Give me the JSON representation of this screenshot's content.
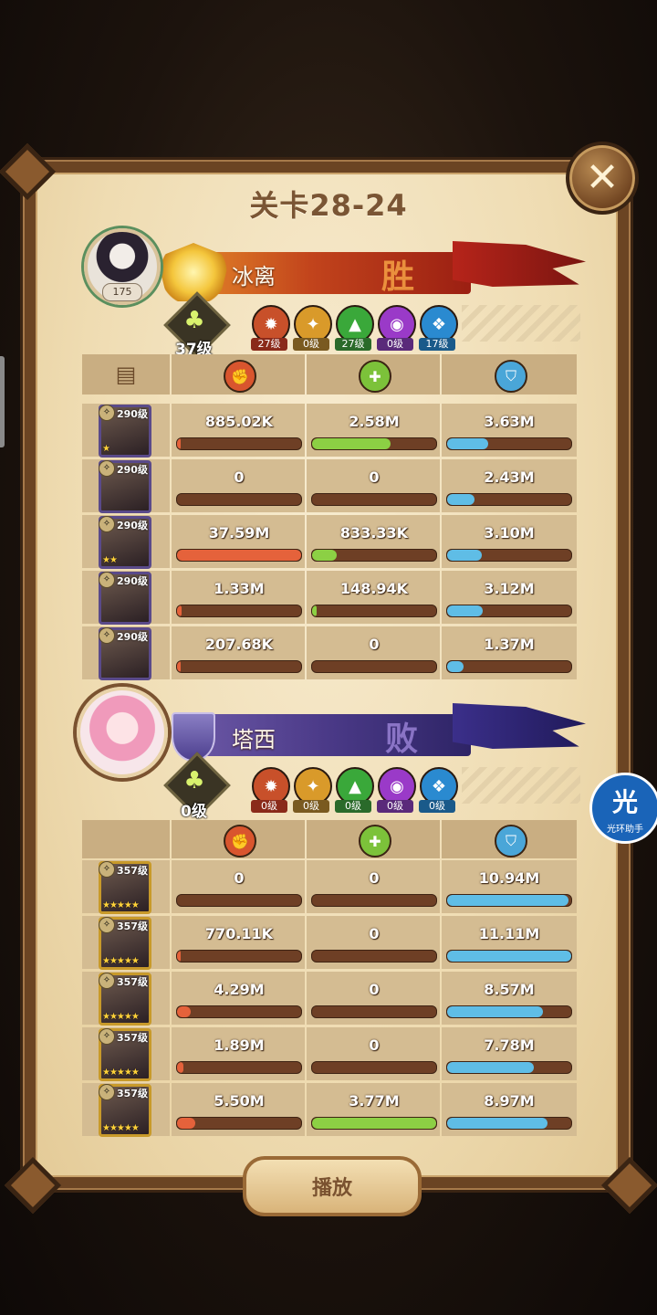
{
  "title": "关卡28-24",
  "close_glyph": "✕",
  "play_label": "播放",
  "floating_widget": {
    "main": "光",
    "sub": "光环助手"
  },
  "icons": {
    "damage": "fist-icon",
    "heal": "heal-icon",
    "defense": "shield-icon",
    "tree": "tree-icon",
    "book": "book-icon"
  },
  "colors": {
    "damage_bar": "#e5623b",
    "heal_bar": "#8cd044",
    "defense_bar": "#5fbde6",
    "win_banner": "#c2441c",
    "lose_banner": "#4b3a88"
  },
  "team_win": {
    "name": "冰离",
    "result": "胜",
    "player_level": "175",
    "tree_level": "37级",
    "factions": [
      {
        "name": "lightbearer",
        "level": "27级"
      },
      {
        "name": "mauler",
        "level": "0级"
      },
      {
        "name": "wilder",
        "level": "27级"
      },
      {
        "name": "graveborn",
        "level": "0级"
      },
      {
        "name": "celestial",
        "level": "17级"
      }
    ],
    "heroes": [
      {
        "level": "290级",
        "stars": "★",
        "damage": "885.02K",
        "damage_pct": 0.02,
        "heal": "2.58M",
        "heal_pct": 0.63,
        "defense": "3.63M",
        "defense_pct": 0.33
      },
      {
        "level": "290级",
        "stars": "",
        "damage": "0",
        "damage_pct": 0,
        "heal": "0",
        "heal_pct": 0,
        "defense": "2.43M",
        "defense_pct": 0.22
      },
      {
        "level": "290级",
        "stars": "★★",
        "damage": "37.59M",
        "damage_pct": 1.0,
        "heal": "833.33K",
        "heal_pct": 0.2,
        "defense": "3.10M",
        "defense_pct": 0.28
      },
      {
        "level": "290级",
        "stars": "",
        "damage": "1.33M",
        "damage_pct": 0.04,
        "heal": "148.94K",
        "heal_pct": 0.04,
        "defense": "3.12M",
        "defense_pct": 0.29
      },
      {
        "level": "290级",
        "stars": "",
        "damage": "207.68K",
        "damage_pct": 0.01,
        "heal": "0",
        "heal_pct": 0,
        "defense": "1.37M",
        "defense_pct": 0.13
      }
    ]
  },
  "team_lose": {
    "name": "塔西",
    "result": "败",
    "tree_level": "0级",
    "factions": [
      {
        "name": "lightbearer",
        "level": "0级"
      },
      {
        "name": "mauler",
        "level": "0级"
      },
      {
        "name": "wilder",
        "level": "0级"
      },
      {
        "name": "graveborn",
        "level": "0级"
      },
      {
        "name": "celestial",
        "level": "0级"
      }
    ],
    "heroes": [
      {
        "level": "357级",
        "stars": "★★★★★",
        "damage": "0",
        "damage_pct": 0,
        "heal": "0",
        "heal_pct": 0,
        "defense": "10.94M",
        "defense_pct": 0.98
      },
      {
        "level": "357级",
        "stars": "★★★★★",
        "damage": "770.11K",
        "damage_pct": 0.02,
        "heal": "0",
        "heal_pct": 0,
        "defense": "11.11M",
        "defense_pct": 1.0
      },
      {
        "level": "357级",
        "stars": "★★★★★",
        "damage": "4.29M",
        "damage_pct": 0.11,
        "heal": "0",
        "heal_pct": 0,
        "defense": "8.57M",
        "defense_pct": 0.77
      },
      {
        "level": "357级",
        "stars": "★★★★★",
        "damage": "1.89M",
        "damage_pct": 0.05,
        "heal": "0",
        "heal_pct": 0,
        "defense": "7.78M",
        "defense_pct": 0.7
      },
      {
        "level": "357级",
        "stars": "★★★★★",
        "damage": "5.50M",
        "damage_pct": 0.15,
        "heal": "3.77M",
        "heal_pct": 1.0,
        "defense": "8.97M",
        "defense_pct": 0.81
      }
    ]
  }
}
